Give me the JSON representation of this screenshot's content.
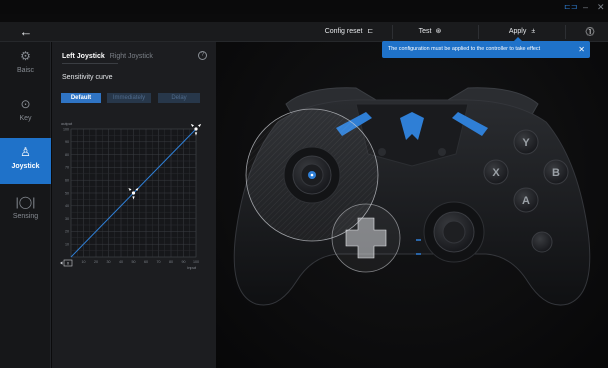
{
  "window": {
    "gamepad_glyph": "⊏⊐",
    "minimize_glyph": "–",
    "close_glyph": "✕"
  },
  "toolbar": {
    "back_glyph": "←",
    "config_reset_label": "Config reset",
    "config_reset_glyph": "⊏",
    "test_label": "Test",
    "test_glyph": "⊛",
    "apply_label": "Apply",
    "apply_glyph": "±",
    "info_glyph": "⓵"
  },
  "sidebar": {
    "items": [
      {
        "label": "Baisc",
        "icon": "⚙",
        "icon_name": "gear-icon"
      },
      {
        "label": "Key",
        "icon": "⊙",
        "icon_name": "gamepad-icon"
      },
      {
        "label": "Joystick",
        "icon": "♙",
        "icon_name": "joystick-icon",
        "active": true
      },
      {
        "label": "Sensing",
        "icon": "|◯|",
        "icon_name": "sensing-icon"
      }
    ]
  },
  "panel": {
    "tab_left": "Left Joystick",
    "tab_right": "Right Joystick",
    "help_glyph": "?",
    "curve_title": "Sensitivity curve",
    "presets": [
      "Default",
      "Immediately",
      "Delay"
    ],
    "selected_preset": "Default"
  },
  "toast": {
    "message": "The configuration must be applied to the controller to take effect",
    "close_glyph": "✕"
  },
  "chart_data": {
    "type": "line",
    "xlabel": "input",
    "ylabel": "output",
    "xlim": [
      0,
      100
    ],
    "ylim": [
      0,
      100
    ],
    "x_ticks": [
      "10",
      "20",
      "30",
      "40",
      "50",
      "60",
      "70",
      "80",
      "90",
      "100"
    ],
    "y_ticks": [
      "10",
      "20",
      "30",
      "40",
      "50",
      "60",
      "70",
      "80",
      "90",
      "100"
    ],
    "grid": true,
    "series": [
      {
        "x": [
          0,
          50,
          100
        ],
        "y": [
          0,
          50,
          100
        ]
      }
    ],
    "control_points": [
      {
        "x": 50,
        "y": 50
      },
      {
        "x": 100,
        "y": 100
      }
    ],
    "deadzone_label": "0",
    "line_color": "#2f7fd6"
  },
  "controller": {
    "face_buttons": [
      "Y",
      "X",
      "B",
      "A"
    ],
    "accent": "#2f7fd6"
  }
}
